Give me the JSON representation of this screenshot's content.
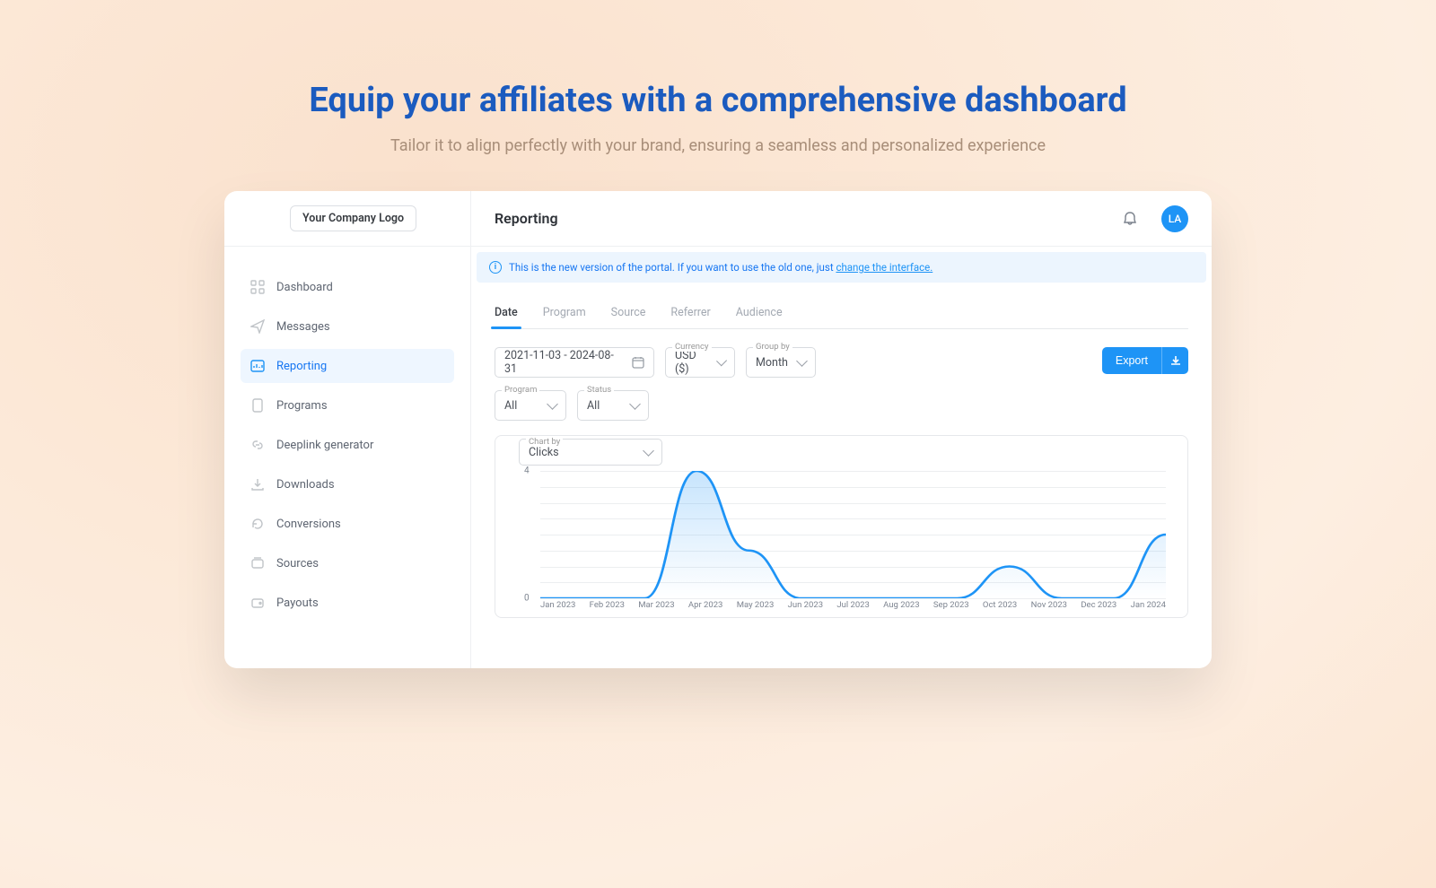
{
  "hero": {
    "title": "Equip your affiliates with  a comprehensive dashboard",
    "subtitle": "Tailor it to align perfectly with your brand, ensuring a seamless and personalized experience"
  },
  "logo": "Your Company Logo",
  "nav": {
    "dashboard": "Dashboard",
    "messages": "Messages",
    "reporting": "Reporting",
    "programs": "Programs",
    "deeplink": "Deeplink generator",
    "downloads": "Downloads",
    "conversions": "Conversions",
    "sources": "Sources",
    "payouts": "Payouts"
  },
  "header": {
    "title": "Reporting",
    "avatar": "LA"
  },
  "banner": {
    "text": "This is the new version of the portal. If you want to use the old one, just ",
    "link": "change the interface."
  },
  "tabs": {
    "date": "Date",
    "program": "Program",
    "source": "Source",
    "referrer": "Referrer",
    "audience": "Audience"
  },
  "filters": {
    "date_value": "2021-11-03 - 2024-08-31",
    "currency_label": "Currency",
    "currency_value": "USD ($)",
    "groupby_label": "Group by",
    "groupby_value": "Month",
    "program_label": "Program",
    "program_value": "All",
    "status_label": "Status",
    "status_value": "All",
    "export_label": "Export"
  },
  "chartby": {
    "label": "Chart by",
    "value": "Clicks"
  },
  "chart_data": {
    "type": "area",
    "title": "",
    "xlabel": "",
    "ylabel": "",
    "ylim": [
      0,
      4
    ],
    "yticks": [
      0,
      4
    ],
    "categories": [
      "Jan 2023",
      "Feb 2023",
      "Mar 2023",
      "Apr 2023",
      "May 2023",
      "Jun 2023",
      "Jul 2023",
      "Aug 2023",
      "Sep 2023",
      "Oct 2023",
      "Nov 2023",
      "Dec 2023",
      "Jan 2024"
    ],
    "series": [
      {
        "name": "Clicks",
        "values": [
          0,
          0,
          0,
          4,
          1.5,
          0,
          0,
          0,
          0,
          1,
          0,
          0,
          2
        ]
      }
    ]
  }
}
